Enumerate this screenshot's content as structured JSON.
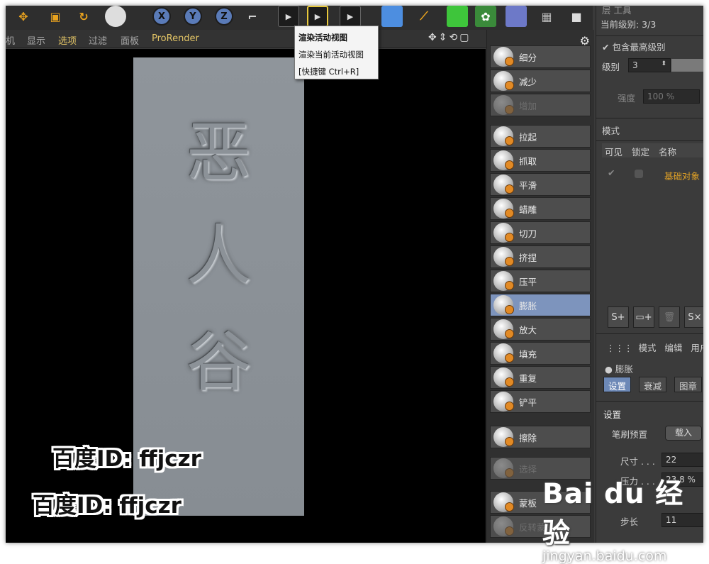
{
  "menubar": {
    "items": [
      "机",
      "显示",
      "选项",
      "过滤",
      "面板",
      "ProRender"
    ]
  },
  "toolbar": {
    "axis_x": "X",
    "axis_y": "Y",
    "axis_z": "Z"
  },
  "tooltip": {
    "line1": "渲染活动视图",
    "line2": "渲染当前活动视图",
    "line3": "[快捷键 Ctrl+R]"
  },
  "viewport": {
    "plaque_text": [
      "恶",
      "人",
      "谷"
    ],
    "watermark": "百度ID: ffjczr"
  },
  "tools": [
    {
      "label": "细分",
      "state": "normal"
    },
    {
      "label": "减少",
      "state": "normal"
    },
    {
      "label": "增加",
      "state": "dim"
    },
    {
      "label": "拉起",
      "state": "normal"
    },
    {
      "label": "抓取",
      "state": "normal"
    },
    {
      "label": "平滑",
      "state": "normal"
    },
    {
      "label": "蜡雕",
      "state": "normal"
    },
    {
      "label": "切刀",
      "state": "normal"
    },
    {
      "label": "挤捏",
      "state": "normal"
    },
    {
      "label": "压平",
      "state": "normal"
    },
    {
      "label": "膨胀",
      "state": "active"
    },
    {
      "label": "放大",
      "state": "normal"
    },
    {
      "label": "填充",
      "state": "normal"
    },
    {
      "label": "重复",
      "state": "normal"
    },
    {
      "label": "铲平",
      "state": "normal"
    },
    {
      "label": "擦除",
      "state": "normal"
    },
    {
      "label": "选择",
      "state": "dim"
    },
    {
      "label": "蒙板",
      "state": "normal"
    },
    {
      "label": "反转蒙板",
      "state": "dim"
    }
  ],
  "panel": {
    "header": "层  工具",
    "current_level": "当前级别: 3/3",
    "include_top": "包含最高级别",
    "level_label": "级别",
    "level_value": "3",
    "strength_label": "强度",
    "strength_value": "100 %",
    "mode_label": "模式",
    "col_visible": "可见",
    "col_lock": "锁定",
    "col_name": "名称",
    "layer_name": "基础对象",
    "bottom_menu": [
      "模式",
      "编辑",
      "用户"
    ],
    "brush_name": "膨胀",
    "tabs": [
      "设置",
      "衰减",
      "图章"
    ],
    "settings_title": "设置",
    "preset_label": "笔刷预置",
    "preset_button": "载入",
    "size_label": "尺寸 . . .",
    "size_value": "22",
    "pressure_label": "压力 . . .",
    "pressure_value": "23.8 %",
    "spacing_label": "步长",
    "spacing_value": "11"
  },
  "site_watermark": {
    "logo": "Bai du 经验",
    "url": "jingyan.baidu.com"
  },
  "colors": {
    "accent_active": "#7d94bd",
    "menu_highlight": "#e3c566",
    "layer_name_color": "#e3a326"
  }
}
